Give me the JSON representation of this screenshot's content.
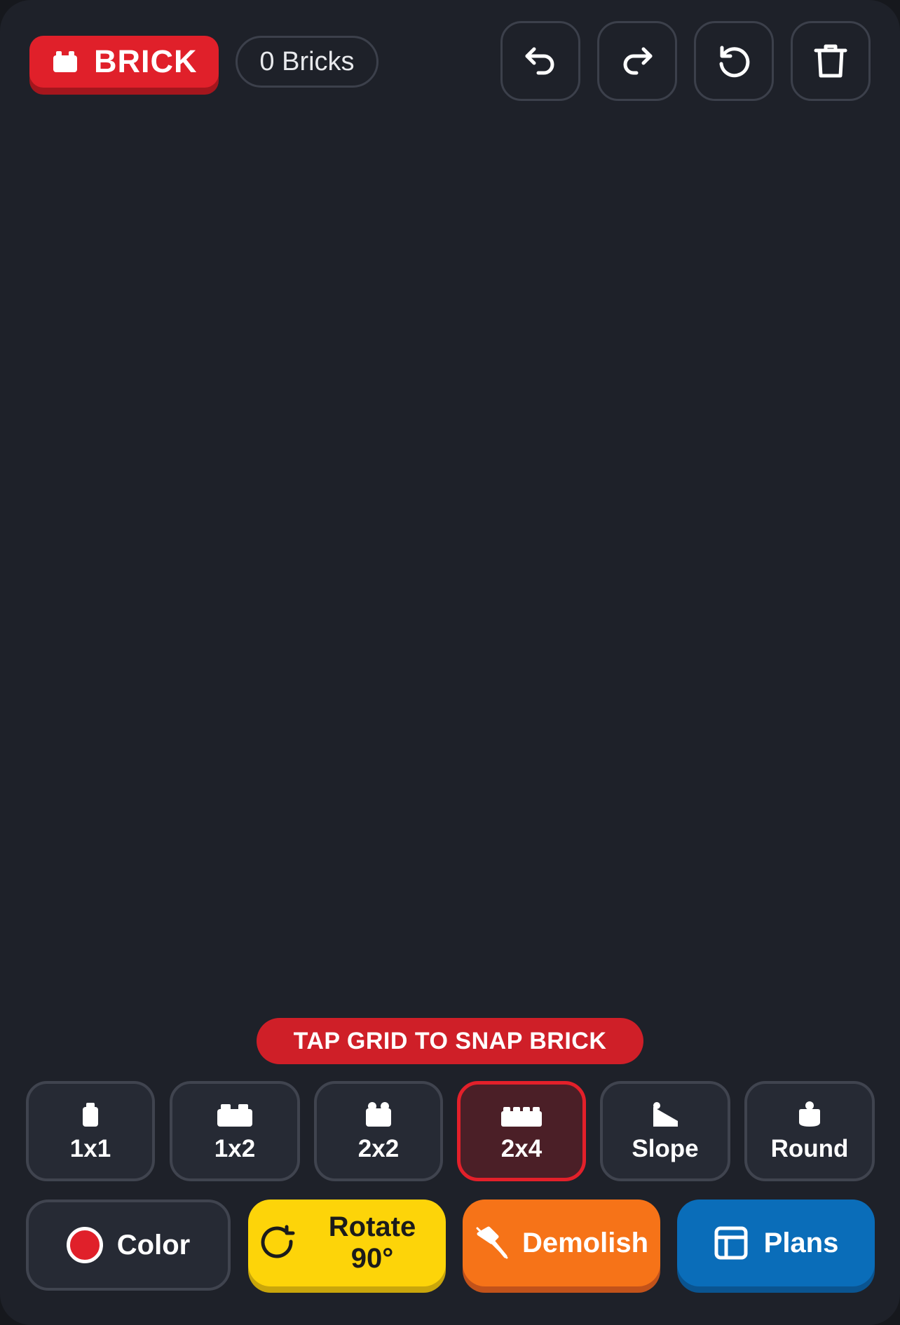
{
  "header": {
    "logo_text": "BRICK",
    "logo_icon": "brick-icon",
    "brick_count": "0 Bricks",
    "tools": [
      {
        "name": "undo",
        "icon": "undo-icon"
      },
      {
        "name": "redo",
        "icon": "redo-icon"
      },
      {
        "name": "reset",
        "icon": "reset-icon"
      },
      {
        "name": "trash",
        "icon": "trash-icon"
      }
    ]
  },
  "hint": "TAP GRID TO SNAP BRICK",
  "bricks": [
    {
      "label": "1x1",
      "icon": "brick-1x1-icon",
      "selected": false
    },
    {
      "label": "1x2",
      "icon": "brick-1x2-icon",
      "selected": false
    },
    {
      "label": "2x2",
      "icon": "brick-2x2-icon",
      "selected": false
    },
    {
      "label": "2x4",
      "icon": "brick-2x4-icon",
      "selected": true
    },
    {
      "label": "Slope",
      "icon": "brick-slope-icon",
      "selected": false
    },
    {
      "label": "Round",
      "icon": "brick-round-icon",
      "selected": false
    }
  ],
  "actions": {
    "color_label": "Color",
    "current_color": "#e0202a",
    "rotate_line1": "Rotate",
    "rotate_line2": "90°",
    "demolish_label": "Demolish",
    "plans_label": "Plans"
  },
  "colors": {
    "accent": "#e0202a",
    "rotate": "#fdd409",
    "demolish": "#f67318",
    "plans": "#0a6db9"
  }
}
